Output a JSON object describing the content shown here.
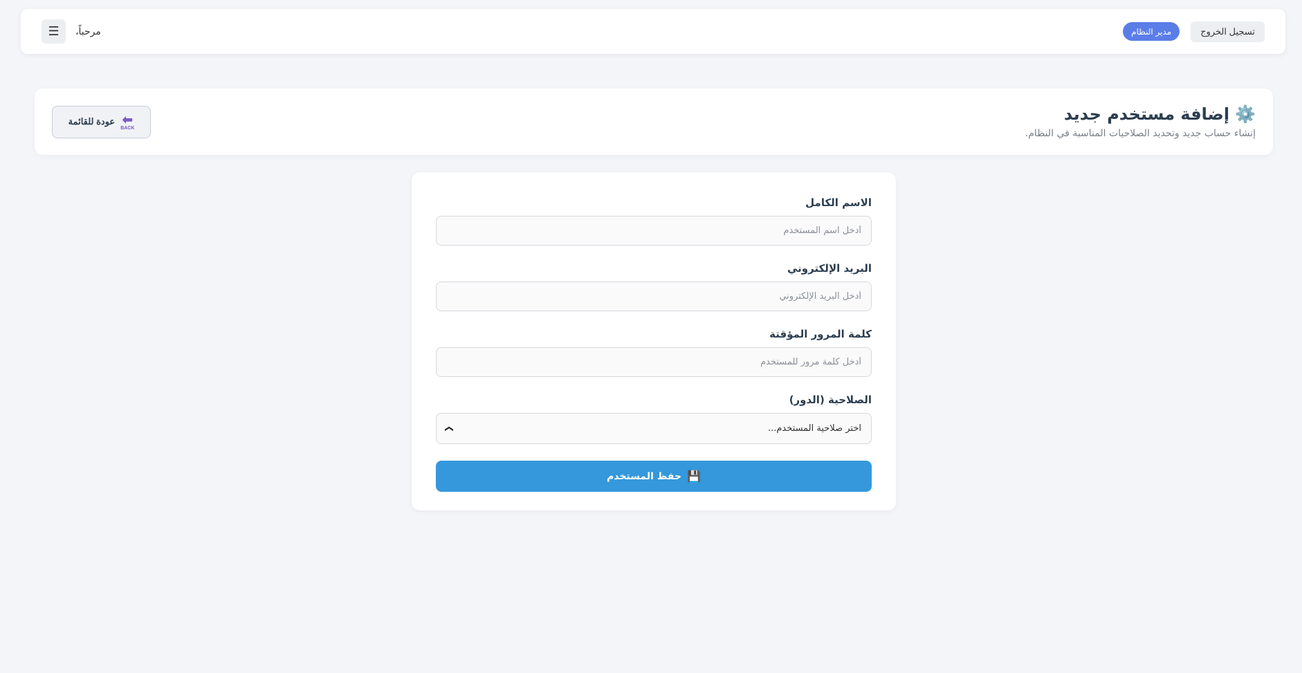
{
  "topbar": {
    "logout_label": "تسجيل الخروج",
    "role_badge": "مدير النظام",
    "welcome_text": "مرحباً،",
    "menu_icon": "☰"
  },
  "header": {
    "title": "إضافة مستخدم جديد",
    "title_icon": "⚙️",
    "subtitle": "إنشاء حساب جديد وتحديد الصلاحيات المناسبة في النظام.",
    "back_label": "عودة للقائمة",
    "back_icon_text": "BACK"
  },
  "form": {
    "full_name": {
      "label": "الاسم الكامل",
      "placeholder": "أدخل اسم المستخدم",
      "value": ""
    },
    "email": {
      "label": "البريد الإلكتروني",
      "placeholder": "أدخل البريد الإلكتروني",
      "value": ""
    },
    "password": {
      "label": "كلمة المرور المؤقتة",
      "placeholder": "أدخل كلمة مرور للمستخدم",
      "value": ""
    },
    "role": {
      "label": "الصلاحية (الدور)",
      "selected": "اختر صلاحية المستخدم..."
    },
    "save_label": "حفظ المستخدم",
    "save_icon": "💾"
  },
  "colors": {
    "primary": "#3598dc",
    "badge": "#5b7de8",
    "background": "#f4f5f9"
  }
}
